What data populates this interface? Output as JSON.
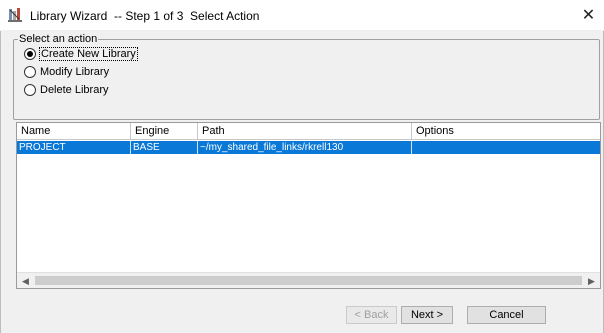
{
  "window": {
    "title": "Library Wizard  -- Step 1 of 3  Select Action",
    "close_icon": "close-icon",
    "app_icon": "library-wizard-icon"
  },
  "action_group": {
    "legend": "Select an action",
    "options": [
      {
        "label": "Create New Library",
        "checked": true
      },
      {
        "label": "Modify Library",
        "checked": false
      },
      {
        "label": "Delete Library",
        "checked": false
      }
    ]
  },
  "table": {
    "columns": [
      "Name",
      "Engine",
      "Path",
      "Options"
    ],
    "rows": [
      {
        "name": "PROJECT",
        "engine": "BASE",
        "path": "~/my_shared_file_links/rkrell130",
        "options": "",
        "selected": true
      }
    ]
  },
  "buttons": {
    "back": "< Back",
    "next": "Next >",
    "cancel": "Cancel"
  },
  "colors": {
    "selection": "#0a78d7",
    "dialog_bg": "#f0f0f0"
  }
}
